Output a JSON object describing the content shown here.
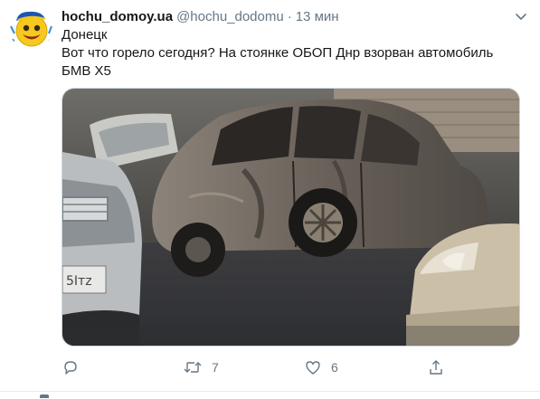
{
  "tweet": {
    "display_name": "hochu_domoy.ua",
    "handle": "@hochu_dodomu",
    "separator": "·",
    "time": "13 мин",
    "text_lines": [
      "Донецк",
      "Вот что горело сегодня? На стоянке ОБОП Днр взорван автомобиль",
      "БМВ Х5"
    ]
  },
  "avatar": {
    "icon": "emoji-face-icon",
    "colors": {
      "face": "#f7c81e",
      "hat": "#1a57b5"
    }
  },
  "media": {
    "description_icon": "burned-car-photo"
  },
  "actions": {
    "reply": {
      "icon": "reply-icon",
      "count": ""
    },
    "retweet": {
      "icon": "retweet-icon",
      "count": "7"
    },
    "like": {
      "icon": "heart-icon",
      "count": "6"
    },
    "share": {
      "icon": "share-icon",
      "count": ""
    }
  },
  "colors": {
    "secondary_text": "#657786",
    "primary_text": "#14171a"
  }
}
